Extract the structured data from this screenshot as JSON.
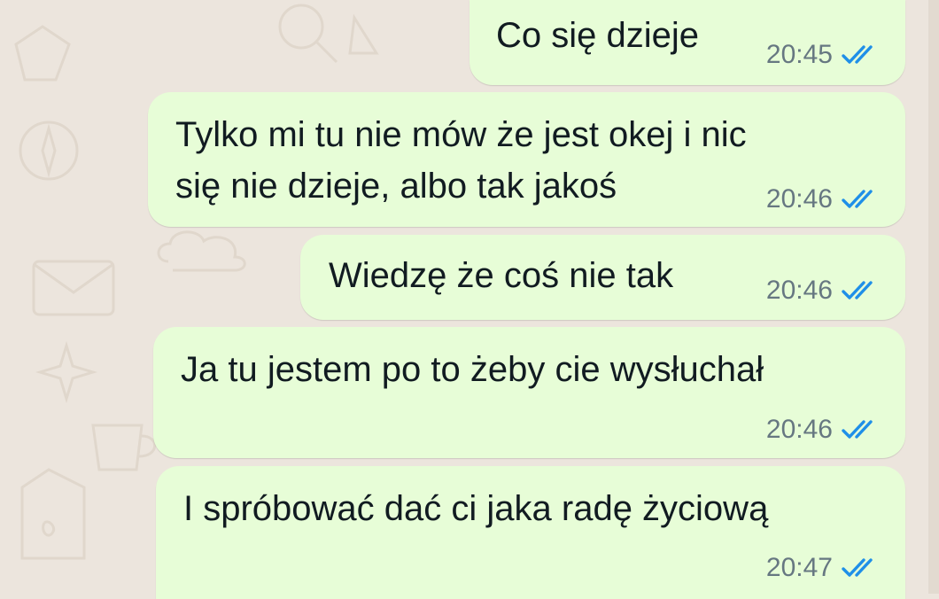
{
  "chat": {
    "messages": [
      {
        "lines": [
          "Co się dzieje"
        ],
        "time": "20:45",
        "status_icon": "double-check-read-icon"
      },
      {
        "lines": [
          "Tylko mi tu nie mów że jest okej i nic",
          "się nie dzieje, albo tak jakoś"
        ],
        "time": "20:46",
        "status_icon": "double-check-read-icon"
      },
      {
        "lines": [
          "Wiedzę że coś nie tak"
        ],
        "time": "20:46",
        "status_icon": "double-check-read-icon"
      },
      {
        "lines": [
          "Ja tu jestem po to żeby cie wysłuchał"
        ],
        "time": "20:46",
        "status_icon": "double-check-read-icon"
      },
      {
        "lines": [
          "I spróbować dać ci jaka radę życiową"
        ],
        "time": "20:47",
        "status_icon": "double-check-read-icon"
      }
    ]
  },
  "colors": {
    "wallpaper": "#ece5dd",
    "outgoing_bubble": "#e7fdd7",
    "message_text": "#111b21",
    "timestamp": "#667781",
    "read_ticks": "#1f8fe8"
  }
}
